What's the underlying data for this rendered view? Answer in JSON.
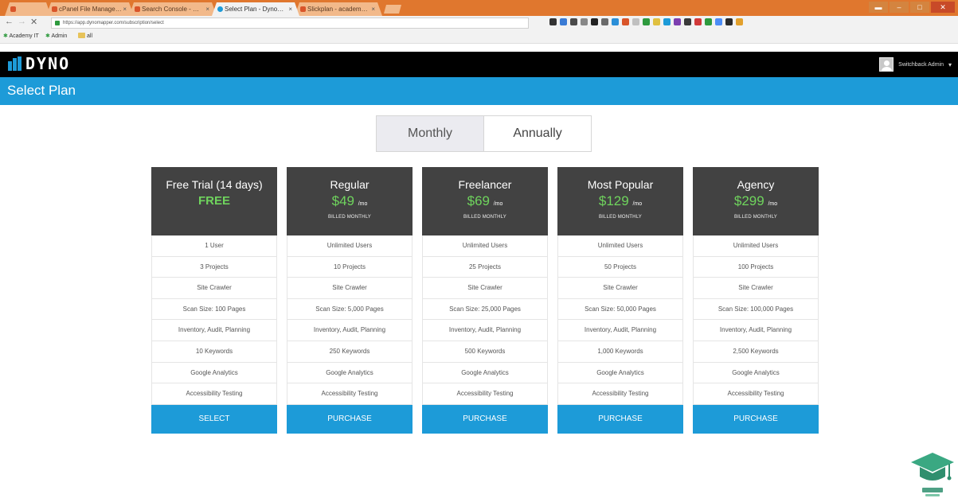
{
  "browser": {
    "tabs": [
      {
        "label": "",
        "active": false
      },
      {
        "label": "cPanel File Manage…",
        "active": false
      },
      {
        "label": "Search Console - …",
        "active": false
      },
      {
        "label": "Select Plan - Dyno…",
        "active": true
      },
      {
        "label": "Slickplan - academ…",
        "active": false
      }
    ],
    "url": "https://app.dynomapper.com/subscription/select",
    "bookmarks": [
      {
        "label": "Academy IT",
        "icon": "star-icon"
      },
      {
        "label": "Admin",
        "icon": "star-icon"
      },
      {
        "label": "all",
        "icon": "folder-icon"
      }
    ],
    "extension_colors": [
      "#333333",
      "#3a7bd5",
      "#4a4a4a",
      "#888888",
      "#222222",
      "#6a6a6a",
      "#2b8fd8",
      "#d9552a",
      "#c0c0c0",
      "#2e9a3e",
      "#e0c040",
      "#1d9bd8",
      "#7d3fb0",
      "#3a3a3a",
      "#d13a3a",
      "#2e9a3e",
      "#4c8df6",
      "#2b2b2b",
      "#e2a02c"
    ]
  },
  "app": {
    "logo_text": "DYNO",
    "user_name": "Switchback Admin",
    "page_title": "Select Plan"
  },
  "billing": {
    "options": [
      "Monthly",
      "Annually"
    ],
    "selected": "Monthly"
  },
  "plans": [
    {
      "name": "Free Trial (14 days)",
      "price": "FREE",
      "billed": "",
      "features": [
        "1 User",
        "3 Projects",
        "Site Crawler",
        "Scan Size: 100 Pages",
        "Inventory, Audit, Planning",
        "10 Keywords",
        "Google Analytics",
        "Accessibility Testing"
      ],
      "button": "SELECT"
    },
    {
      "name": "Regular",
      "price": "$49",
      "unit": "/mo",
      "billed": "BILLED MONTHLY",
      "features": [
        "Unlimited Users",
        "10 Projects",
        "Site Crawler",
        "Scan Size: 5,000 Pages",
        "Inventory, Audit, Planning",
        "250 Keywords",
        "Google Analytics",
        "Accessibility Testing"
      ],
      "button": "PURCHASE"
    },
    {
      "name": "Freelancer",
      "price": "$69",
      "unit": "/mo",
      "billed": "BILLED MONTHLY",
      "features": [
        "Unlimited Users",
        "25 Projects",
        "Site Crawler",
        "Scan Size: 25,000 Pages",
        "Inventory, Audit, Planning",
        "500 Keywords",
        "Google Analytics",
        "Accessibility Testing"
      ],
      "button": "PURCHASE"
    },
    {
      "name": "Most Popular",
      "price": "$129",
      "unit": "/mo",
      "billed": "BILLED MONTHLY",
      "features": [
        "Unlimited Users",
        "50 Projects",
        "Site Crawler",
        "Scan Size: 50,000 Pages",
        "Inventory, Audit, Planning",
        "1,000 Keywords",
        "Google Analytics",
        "Accessibility Testing"
      ],
      "button": "PURCHASE"
    },
    {
      "name": "Agency",
      "price": "$299",
      "unit": "/mo",
      "billed": "BILLED MONTHLY",
      "features": [
        "Unlimited Users",
        "100 Projects",
        "Site Crawler",
        "Scan Size: 100,000 Pages",
        "Inventory, Audit, Planning",
        "2,500 Keywords",
        "Google Analytics",
        "Accessibility Testing"
      ],
      "button": "PURCHASE"
    }
  ],
  "colors": {
    "accent": "#1d9bd8",
    "price_green": "#6fd45d",
    "card_header": "#424242",
    "header_bg": "#000000",
    "chrome_tabbar": "#e0772e"
  }
}
